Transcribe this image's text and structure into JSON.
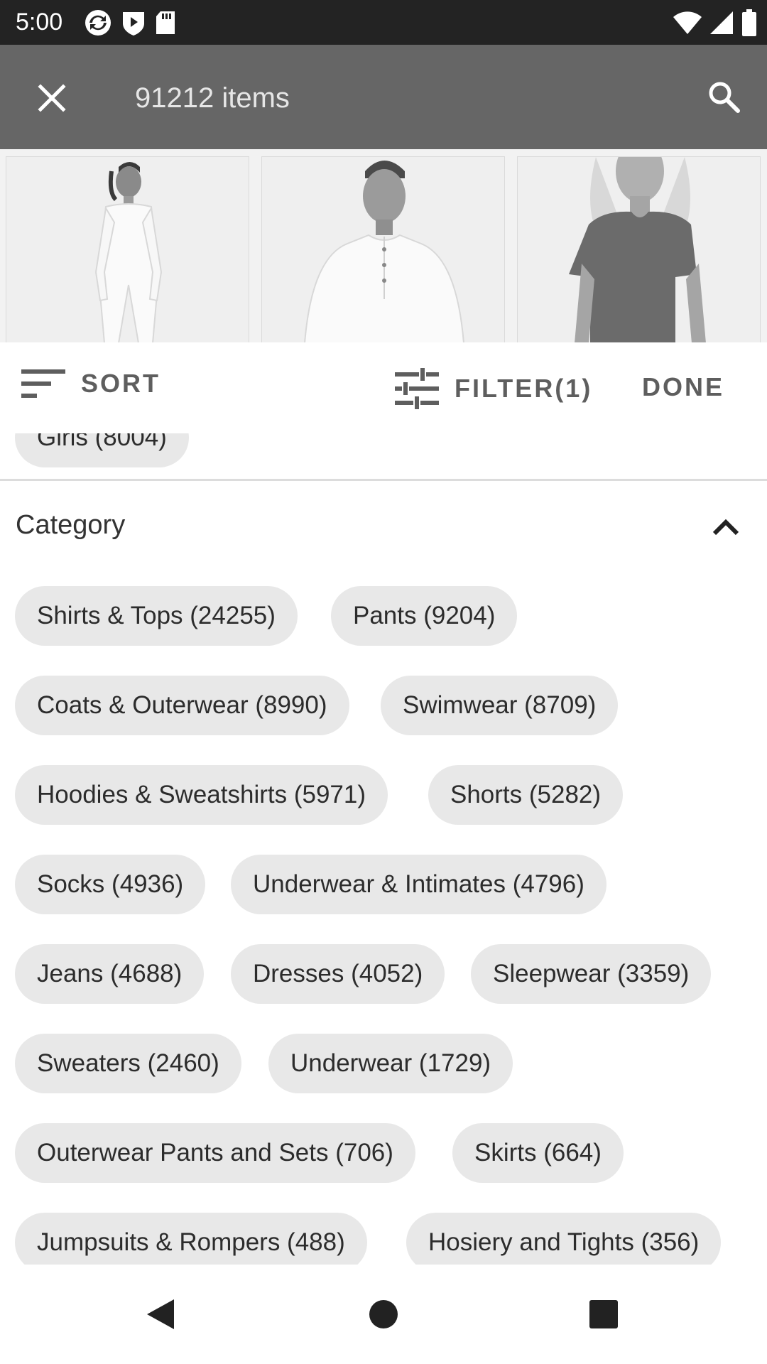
{
  "status_bar": {
    "time": "5:00"
  },
  "app_bar": {
    "title": "91212 items"
  },
  "products": [
    {
      "name": "Women's white long-sleeve jumpsuit"
    },
    {
      "name": "Men's white henley shirt"
    },
    {
      "name": "Women's gray ruffle t-shirt"
    }
  ],
  "toolbar": {
    "sort_label": "SORT",
    "filter_label": "FILTER(1)",
    "done_label": "DONE"
  },
  "previous_chip": "Girls (8004)",
  "category": {
    "title": "Category",
    "chips": [
      "Shirts & Tops (24255)",
      "Pants (9204)",
      "Coats & Outerwear (8990)",
      "Swimwear (8709)",
      "Hoodies & Sweatshirts (5971)",
      "Shorts (5282)",
      "Socks (4936)",
      "Underwear & Intimates (4796)",
      "Jeans (4688)",
      "Dresses (4052)",
      "Sleepwear (3359)",
      "Sweaters (2460)",
      "Underwear (1729)",
      "Outerwear Pants and Sets (706)",
      "Skirts (664)",
      "Jumpsuits & Rompers (488)",
      "Hosiery and Tights (356)"
    ]
  }
}
